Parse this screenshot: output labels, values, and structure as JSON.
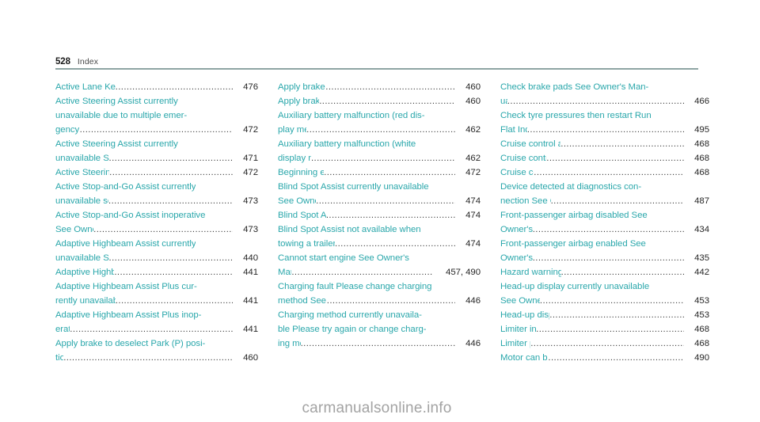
{
  "header": {
    "folio": "528",
    "title": "Index",
    "rule_color": "#8ea5a3"
  },
  "colors": {
    "entry_text": "#2aa7ab",
    "page_number": "#262626",
    "leader": "#3a3a3a",
    "watermark": "#a3a3a3"
  },
  "watermark": "carmanualsonline.info",
  "columns": [
    {
      "id": "column-1",
      "entries": [
        {
          "lines": [
            "Active Lane Keeping Assist inoperative"
          ],
          "page": "476"
        },
        {
          "lines": [
            "Active Steering Assist currently",
            "unavailable due to multiple emer-",
            "gency stops"
          ],
          "page": "472"
        },
        {
          "lines": [
            "Active Steering Assist currently",
            "unavailable See Owner's Manual"
          ],
          "page": "471"
        },
        {
          "lines": [
            "Active Steering Assist inoperative"
          ],
          "page": "472"
        },
        {
          "lines": [
            "Active Stop-and-Go Assist currently",
            "unavailable see Owner's Manual"
          ],
          "page": "473"
        },
        {
          "lines": [
            "Active Stop-and-Go Assist inoperative",
            "See Owner's Manual"
          ],
          "page": "473"
        },
        {
          "lines": [
            "Adaptive Highbeam Assist currently",
            "unavailable See Owner's Manual"
          ],
          "page": "440"
        },
        {
          "lines": [
            "Adaptive Highbeam Assist inoperative"
          ],
          "page": "441"
        },
        {
          "lines": [
            "Adaptive Highbeam Assist Plus cur-",
            "rently unavailable See Owner's Manual"
          ],
          "page": "441"
        },
        {
          "lines": [
            "Adaptive Highbeam Assist Plus inop-",
            "erative"
          ],
          "page": "441"
        },
        {
          "lines": [
            "Apply brake to deselect Park (P) posi-",
            "tion"
          ],
          "page": "460"
        }
      ]
    },
    {
      "id": "column-2",
      "entries": [
        {
          "lines": [
            "Apply brake to select D or R"
          ],
          "page": "460"
        },
        {
          "lines": [
            "Apply brake to select R"
          ],
          "page": "460"
        },
        {
          "lines": [
            "Auxiliary battery malfunction  (red dis-",
            "play message)"
          ],
          "page": "462"
        },
        {
          "lines": [
            "Auxiliary battery malfunction  (white",
            "display message)"
          ],
          "page": "462"
        },
        {
          "lines": [
            "Beginning emergency stop"
          ],
          "page": "472"
        },
        {
          "lines": [
            "Blind Spot Assist currently unavailable",
            "See Owner's Manual"
          ],
          "page": "474"
        },
        {
          "lines": [
            "Blind Spot Assist inoperative"
          ],
          "page": "474"
        },
        {
          "lines": [
            "Blind Spot Assist not available when",
            "towing a trailer See Owner's Manual"
          ],
          "page": "474"
        },
        {
          "lines": [
            "Cannot start engine See Owner's",
            "Manual"
          ],
          "page": "457, 490",
          "wide": true
        },
        {
          "lines": [
            "Charging fault Please change charging",
            "method See Owner's Manual"
          ],
          "page": "446"
        },
        {
          "lines": [
            "Charging method currently unavaila-",
            "ble Please try again or change charg-",
            "ing method"
          ],
          "page": "446"
        }
      ]
    },
    {
      "id": "column-3",
      "entries": [
        {
          "lines": [
            "Check brake pads See Owner's Man-",
            "ual"
          ],
          "page": "466"
        },
        {
          "lines": [
            "Check tyre pressures then restart Run",
            "Flat Indicator"
          ],
          "page": "495"
        },
        {
          "lines": [
            "Cruise control and Limiter inoperative"
          ],
          "page": "468"
        },
        {
          "lines": [
            "Cruise control inoperative"
          ],
          "page": "468"
        },
        {
          "lines": [
            "Cruise control off"
          ],
          "page": "468"
        },
        {
          "lines": [
            "Device detected at diagnostics con-",
            "nection See Owner's Manual"
          ],
          "page": "487"
        },
        {
          "lines": [
            "Front-passenger airbag disabled See",
            "Owner's Manual"
          ],
          "page": "434"
        },
        {
          "lines": [
            "Front-passenger airbag enabled See",
            "Owner's Manual"
          ],
          "page": "435"
        },
        {
          "lines": [
            "Hazard warning lamps malfunctioning"
          ],
          "page": "442"
        },
        {
          "lines": [
            "Head-up display currently unavailable",
            "See Owner's Manual"
          ],
          "page": "453"
        },
        {
          "lines": [
            "Head-up display inoperative"
          ],
          "page": "453"
        },
        {
          "lines": [
            "Limiter inoperative"
          ],
          "page": "468"
        },
        {
          "lines": [
            "Limiter passive"
          ],
          "page": "468"
        },
        {
          "lines": [
            "Motor can be started again"
          ],
          "page": "490"
        }
      ]
    }
  ]
}
